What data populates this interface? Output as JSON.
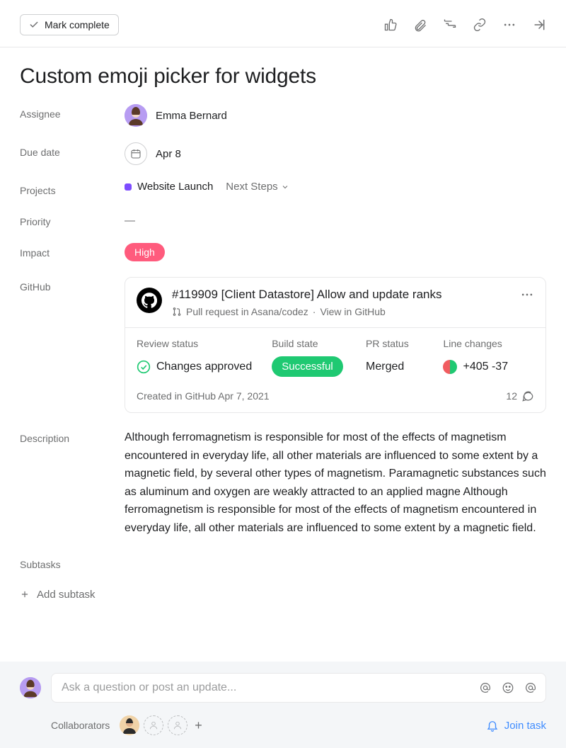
{
  "toolbar": {
    "mark_complete": "Mark complete"
  },
  "task": {
    "title": "Custom emoji picker for widgets",
    "labels": {
      "assignee": "Assignee",
      "due_date": "Due date",
      "projects": "Projects",
      "priority": "Priority",
      "impact": "Impact",
      "github": "GitHub",
      "description": "Description",
      "subtasks": "Subtasks"
    },
    "assignee": "Emma Bernard",
    "due_date": "Apr 8",
    "project_name": "Website Launch",
    "project_section": "Next Steps",
    "priority_value": "—",
    "impact_value": "High",
    "description": "Although ferromagnetism is responsible for most of the effects of magnetism encountered in everyday life, all other materials are influenced to some extent by a magnetic field, by several other types of magnetism. Paramagnetic substances such as aluminum and oxygen are weakly attracted to an applied magne Although ferromagnetism is responsible for most of the effects of magnetism encountered in everyday life, all other materials are influenced to some extent by a magnetic field."
  },
  "github": {
    "title": "#119909 [Client Datastore] Allow and update ranks",
    "repo": "Pull request in Asana/codez",
    "view_link": "View in GitHub",
    "labels": {
      "review": "Review status",
      "build": "Build state",
      "pr": "PR status",
      "lines": "Line changes"
    },
    "review_value": "Changes approved",
    "build_value": "Successful",
    "pr_value": "Merged",
    "lines_value": "+405 -37",
    "created": "Created in GitHub Apr 7, 2021",
    "comments": "12"
  },
  "subtasks": {
    "add": "Add subtask"
  },
  "comment": {
    "placeholder": "Ask a question or post an update..."
  },
  "collab": {
    "label": "Collaborators",
    "join": "Join task"
  }
}
